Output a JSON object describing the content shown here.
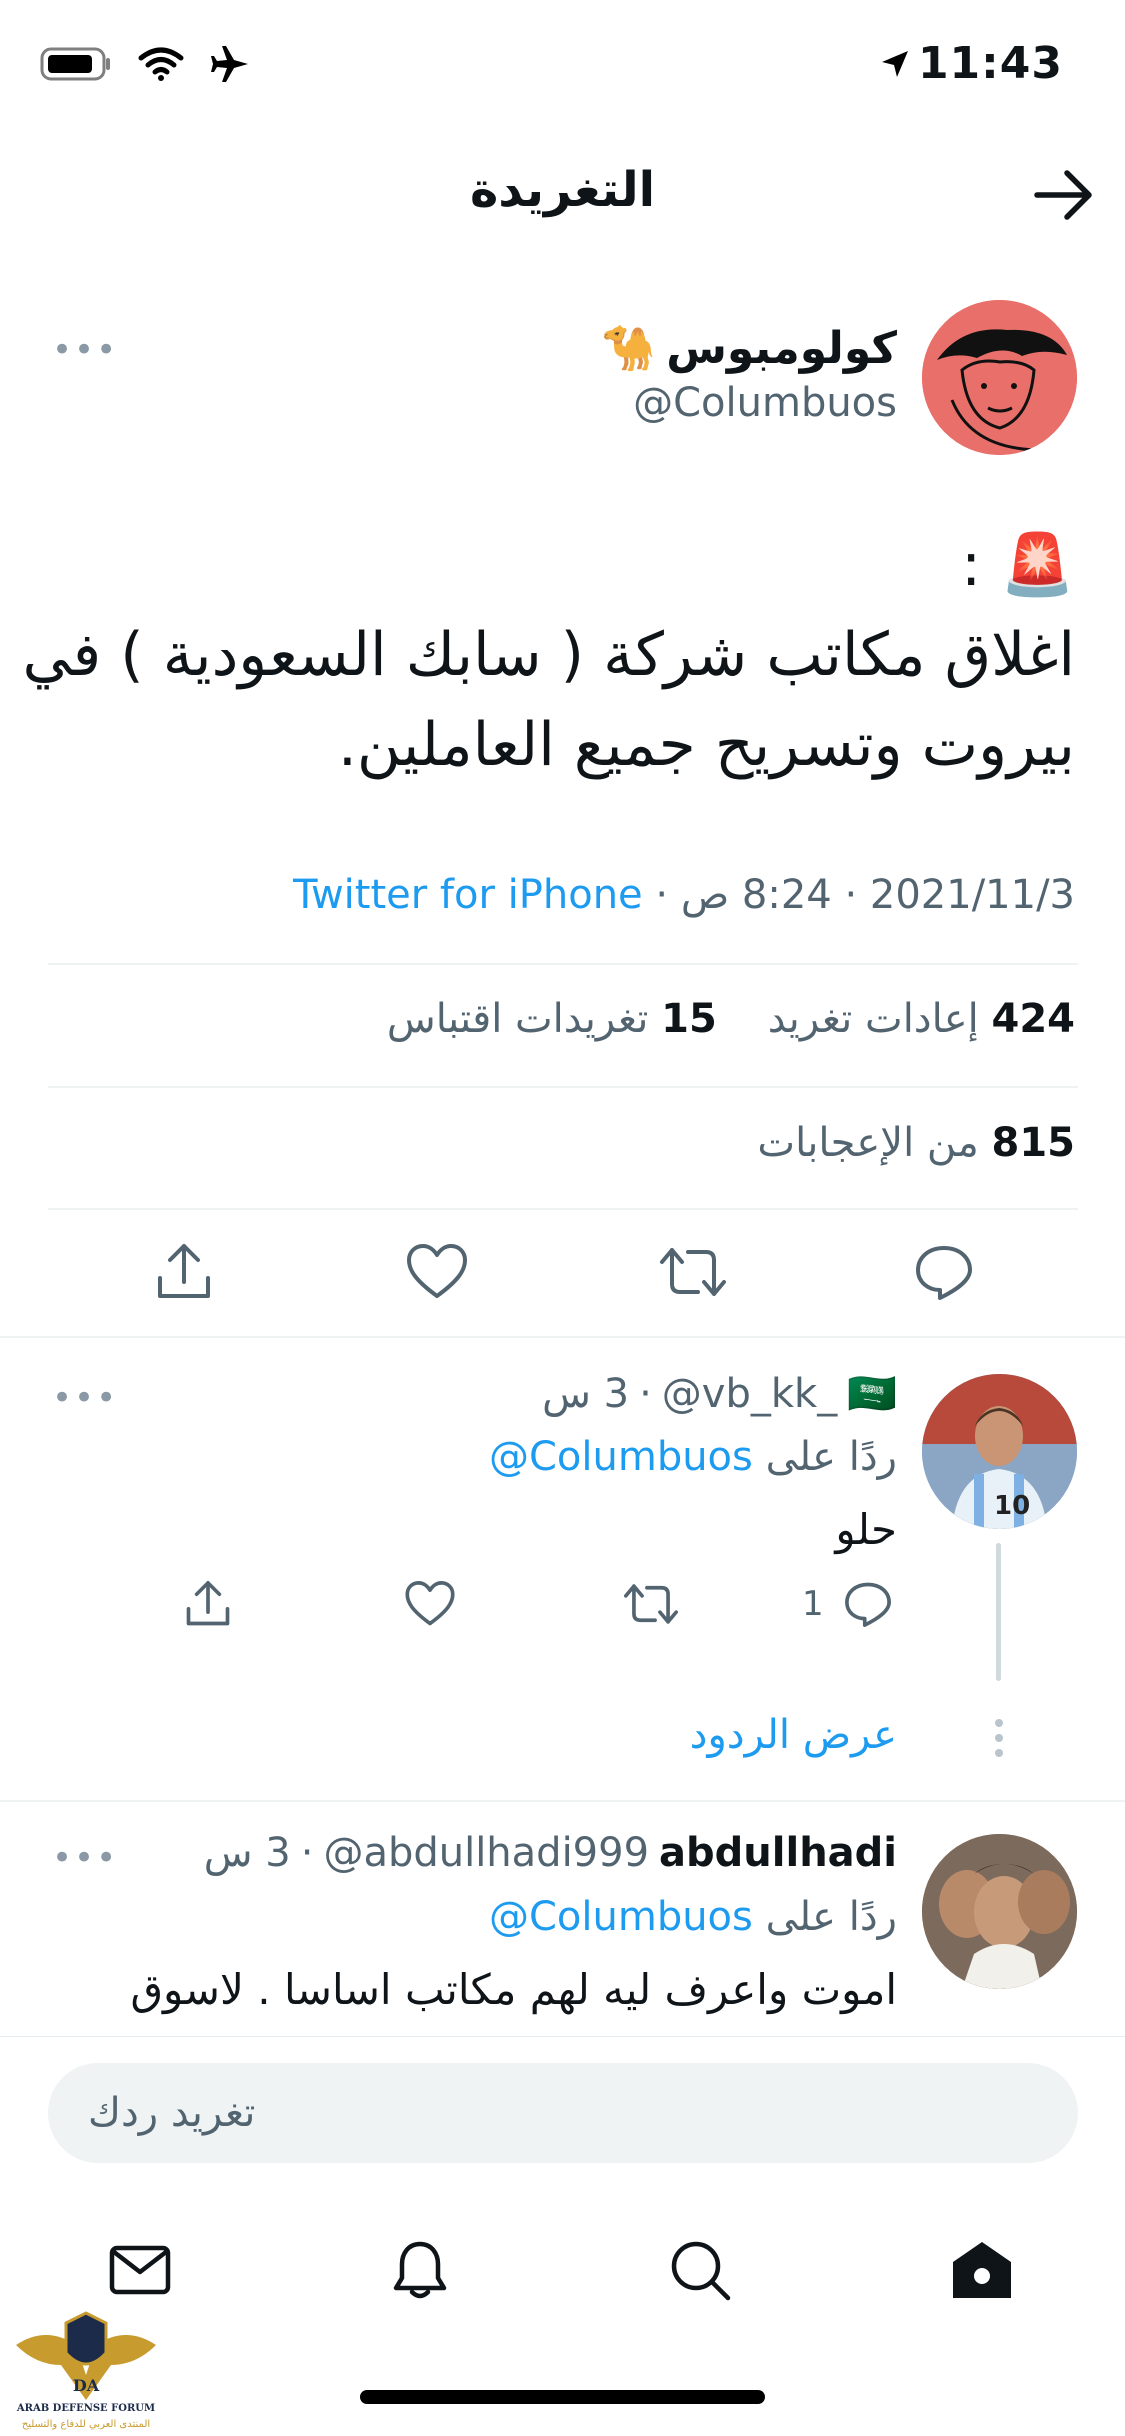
{
  "status_bar": {
    "time": "11:43",
    "icons": [
      "battery-icon",
      "wifi-icon",
      "airplane-icon",
      "location-arrow-icon"
    ]
  },
  "header": {
    "title": "التغريدة",
    "back_icon": "arrow-right-icon"
  },
  "tweet": {
    "author_name": "كولومبوس",
    "author_emoji": "🐪",
    "author_handle": "@Columbuos",
    "text_line1": "🚨 :",
    "text_line2": "اغلاق مكاتب شركة ( سابك السعودية ) في",
    "text_line3": "بيروت وتسريح جميع العاملين.",
    "date": "2021/11/3",
    "time": "8:24 ص",
    "source": "Twitter for iPhone",
    "retweets_count": "424",
    "retweets_label": "إعادات تغريد",
    "quotes_count": "15",
    "quotes_label": "تغريدات اقتباس",
    "likes_count": "815",
    "likes_label": "من الإعجابات"
  },
  "replies": [
    {
      "name": "",
      "flag": "🇸🇦",
      "handle": "@vb_kk_",
      "age": "3 س",
      "reply_prefix": "ردًا على",
      "reply_to": "@Columbuos",
      "text": "حلو",
      "reply_count": "1",
      "show_replies": "عرض الردود"
    },
    {
      "name": "abdullhadi",
      "handle": "@abdullhadi999",
      "age": "3 س",
      "reply_prefix": "ردًا على",
      "reply_to": "@Columbuos",
      "text": "اموت واعرف ليه لهم مكاتب اساسا . لاسوق"
    }
  ],
  "compose": {
    "placeholder": "تغريد ردك"
  },
  "tab_bar": [
    "mail-icon",
    "bell-icon",
    "search-icon",
    "home-icon"
  ],
  "colors": {
    "accent": "#1d9bf0",
    "secondary_text": "#536471",
    "divider": "#eff3f4"
  }
}
